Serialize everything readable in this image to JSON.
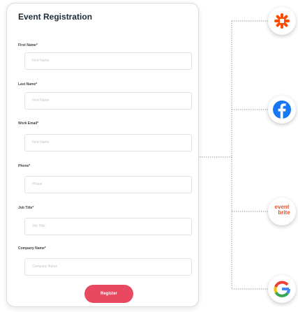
{
  "form": {
    "title": "Event Registration",
    "fields": [
      {
        "label": "First Name*",
        "placeholder": "First Name"
      },
      {
        "label": "Last Name*",
        "placeholder": "First Name"
      },
      {
        "label": "Work Email*",
        "placeholder": "First Name"
      },
      {
        "label": "Phone*",
        "placeholder": "Phone"
      },
      {
        "label": "Job Title*",
        "placeholder": "Job Title"
      },
      {
        "label": "Company Name*",
        "placeholder": "Company Name"
      }
    ],
    "submit_label": "Register"
  },
  "integrations": [
    {
      "name": "zapier",
      "icon": "zapier-icon",
      "color": "#ff4a00"
    },
    {
      "name": "facebook",
      "icon": "facebook-icon",
      "color": "#1877f2"
    },
    {
      "name": "eventbrite",
      "icon": "eventbrite-icon",
      "color": "#e8552f",
      "text_line1": "event",
      "text_line2": "brite"
    },
    {
      "name": "google",
      "icon": "google-icon",
      "colors": [
        "#4285f4",
        "#ea4335",
        "#fbbc05",
        "#34a853"
      ]
    }
  ],
  "colors": {
    "accent": "#e84860",
    "connector": "#9a9a9a"
  }
}
